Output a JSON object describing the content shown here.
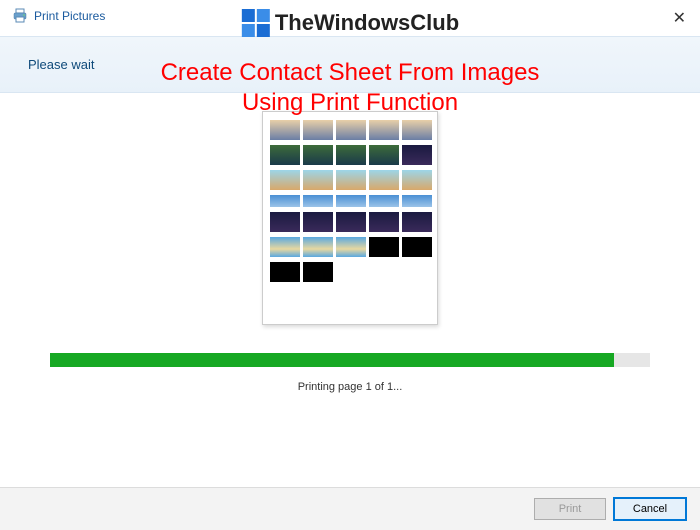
{
  "window": {
    "title": "Print Pictures",
    "close_glyph": "✕"
  },
  "watermark": {
    "text": "TheWindowsClub"
  },
  "overlay": {
    "line1": "Create Contact Sheet From Images",
    "line2": "Using Print Function"
  },
  "header": {
    "message": "Please wait"
  },
  "progress": {
    "percent": 94
  },
  "status": {
    "text": "Printing page 1 of 1..."
  },
  "buttons": {
    "print": "Print",
    "cancel": "Cancel"
  }
}
